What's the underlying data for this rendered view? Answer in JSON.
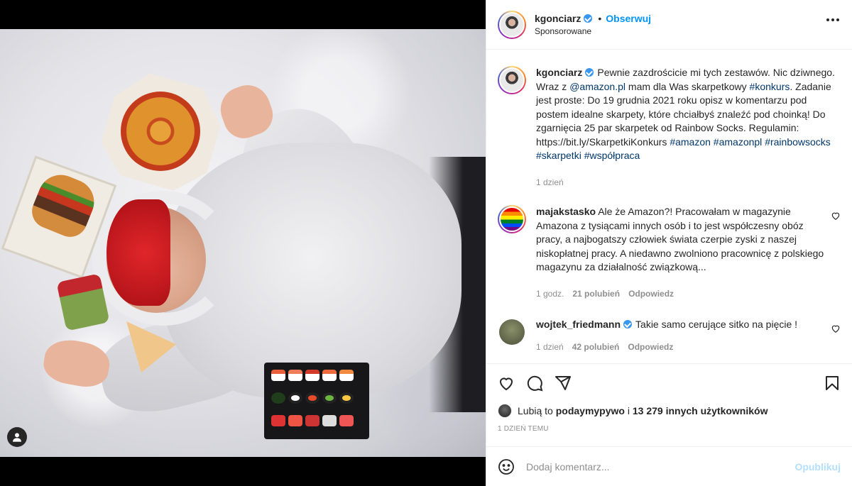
{
  "post": {
    "author": "kgonciarz",
    "follow_label": "Obserwuj",
    "sponsored_label": "Sponsorowane",
    "separator": "•"
  },
  "caption": {
    "author": "kgonciarz",
    "text_1": "Pewnie zazdrościcie mi tych zestawów. Nic dziwnego. Wraz z ",
    "mention": "@amazon.pl",
    "text_2": " mam dla Was skarpetkowy ",
    "tag_konkurs": "#konkurs",
    "text_3": ". Zadanie jest proste: Do 19 grudnia 2021 roku opisz w komentarzu pod postem idealne skarpety, które chciałbyś znaleźć pod choinką! Do zgarnięcia 25 par skarpetek od Rainbow Socks. Regulamin: https://bit.ly/SkarpetkiKonkurs ",
    "tags": [
      "#amazon",
      "#amazonpl",
      "#rainbowsocks",
      "#skarpetki",
      "#współpraca"
    ],
    "time": "1 dzień"
  },
  "comments": [
    {
      "author": "majakstasko",
      "text": "Ale że Amazon?! Pracowałam w magazynie Amazona z tysiącami innych osób i to jest współczesny obóz pracy, a najbogatszy człowiek świata czerpie zyski z naszej niskopłatnej pracy. A niedawno zwolniono pracownicę z polskiego magazynu za działalność związkową...",
      "time": "1 godz.",
      "likes": "21 polubień",
      "reply": "Odpowiedz"
    },
    {
      "author": "wojtek_friedmann",
      "text": "Takie samo cerujące sitko na pięcie !",
      "time": "1 dzień",
      "likes": "42 polubień",
      "reply": "Odpowiedz"
    }
  ],
  "likes_bar": {
    "prefix": "Lubią to ",
    "user": "podaymypywo",
    "middle": " i ",
    "others": "13 279 innych użytkowników"
  },
  "posted_ago": "1 DZIEŃ TEMU",
  "composer": {
    "placeholder": "Dodaj komentarz...",
    "publish": "Opublikuj"
  },
  "colors": {
    "accent": "#0095f6",
    "link": "#00376b",
    "muted": "#8e8e8e",
    "publish_disabled": "#b2dffc"
  },
  "icons": [
    "user-tag-icon",
    "heart-icon",
    "comment-icon",
    "share-icon",
    "bookmark-icon",
    "emoji-icon",
    "more-icon",
    "verified-icon"
  ]
}
